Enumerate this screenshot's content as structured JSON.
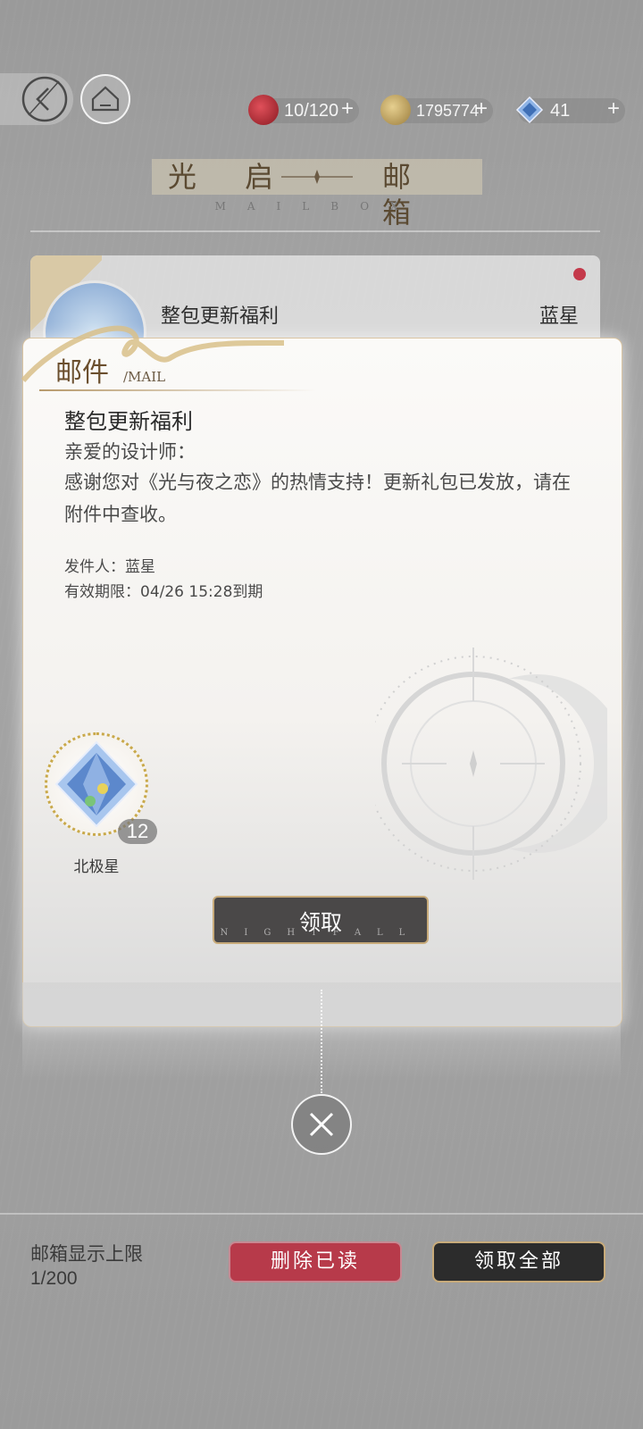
{
  "header": {
    "currencies": [
      {
        "icon": "apple-stamina-icon",
        "value": "10/120",
        "plus": "+"
      },
      {
        "icon": "gold-coin-icon",
        "value": "1795774",
        "plus": "+"
      },
      {
        "icon": "blue-star-icon",
        "value": "41",
        "plus": "+"
      }
    ]
  },
  "page": {
    "title": "光启 邮箱",
    "title_left": "光 启",
    "title_right": "邮 箱",
    "title_sub": "MAILBOX"
  },
  "list": {
    "items": [
      {
        "title": "整包更新福利",
        "sender": "蓝星",
        "unread": true
      }
    ]
  },
  "popup": {
    "tag": "邮件",
    "tag_en": "/MAIL",
    "title": "整包更新福利",
    "greeting": "亲爱的设计师：",
    "body": "感谢您对《光与夜之恋》的热情支持！更新礼包已发放，请在附件中查收。",
    "sender_line": "发件人：蓝星",
    "expiry_line": "有效期限：04/26 15:28到期",
    "attachment": {
      "name": "北极星",
      "count": "12",
      "icon": "diamond-crystal-icon"
    },
    "claim_label": "领取",
    "claim_sub": "NIGHTFALL"
  },
  "footer": {
    "limit_label": "邮箱显示上限",
    "limit_value": "1/200",
    "delete_read_label": "删除已读",
    "claim_all_label": "领取全部"
  },
  "colors": {
    "accent_gold": "#c8ab7a",
    "delete_red": "#b73a4a",
    "dark_button": "#2c2c2c"
  }
}
